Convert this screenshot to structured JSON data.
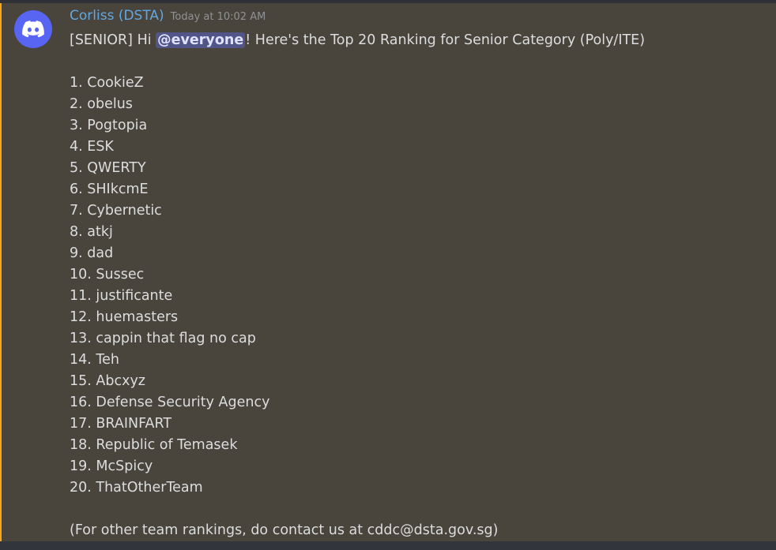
{
  "message": {
    "author": "Corliss (DSTA)",
    "timestamp": "Today at 10:02 AM",
    "intro_prefix": "[SENIOR] Hi ",
    "mention": "@everyone",
    "intro_suffix": "! Here's the Top 20 Ranking for Senior Category (Poly/ITE)",
    "rankings": [
      "1. CookieZ",
      "2. obelus",
      "3. Pogtopia",
      "4. ESK",
      "5. QWERTY",
      "6. SHIkcmE",
      "7. Cybernetic",
      "8. atkj",
      "9. dad",
      "10. Sussec",
      "11. justificante",
      "12. huemasters",
      "13. cappin that flag no cap",
      "14. Teh",
      "15. Abcxyz",
      "16. Defense Security Agency",
      "17. BRAINFART",
      "18. Republic of Temasek",
      "19. McSpicy",
      "20. ThatOtherTeam"
    ],
    "footer": "(For other team rankings, do contact us at cddc@dsta.gov.sg)"
  },
  "avatar_icon": "discord-logo-icon",
  "colors": {
    "avatar_bg": "#5865f2",
    "username": "#62a8e0",
    "mention_bg": "#525587",
    "highlight_bar": "#faa81a",
    "message_bg": "#49443c"
  }
}
